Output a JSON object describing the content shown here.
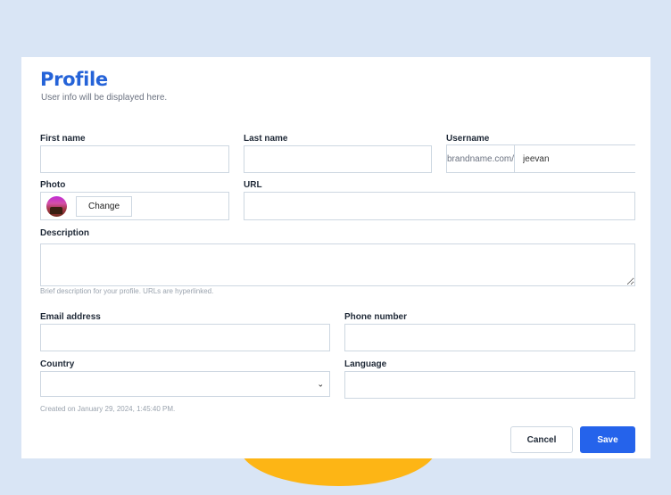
{
  "header": {
    "title": "Profile",
    "subtitle": "User info will be displayed here."
  },
  "form": {
    "first_name": {
      "label": "First name",
      "value": "",
      "placeholder": ""
    },
    "last_name": {
      "label": "Last name",
      "value": "",
      "placeholder": ""
    },
    "username": {
      "label": "Username",
      "prefix": "brandname.com/",
      "value": "jeevan"
    },
    "photo": {
      "label": "Photo",
      "change_label": "Change"
    },
    "url": {
      "label": "URL",
      "value": ""
    },
    "description": {
      "label": "Description",
      "value": "",
      "hint": "Brief description for your profile. URLs are hyperlinked."
    },
    "email": {
      "label": "Email address",
      "value": ""
    },
    "phone": {
      "label": "Phone number",
      "value": ""
    },
    "country": {
      "label": "Country",
      "selected": ""
    },
    "language": {
      "label": "Language",
      "value": ""
    },
    "created": "Created on January 29, 2024, 1:45:40 PM."
  },
  "actions": {
    "cancel_label": "Cancel",
    "save_label": "Save"
  },
  "colors": {
    "page_background": "#d9e5f5",
    "accent": "#2563eb",
    "decor_blob": "#fdb515"
  }
}
